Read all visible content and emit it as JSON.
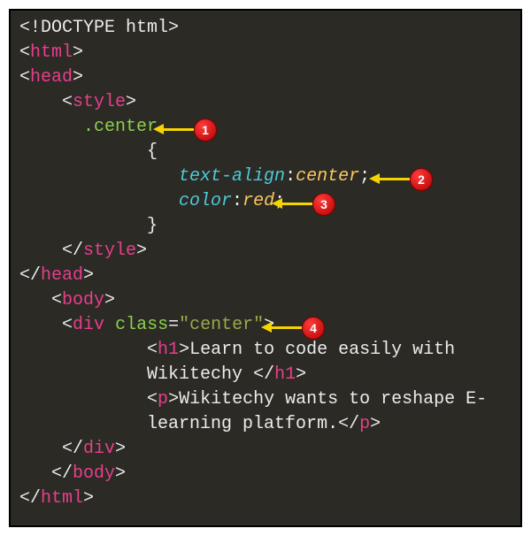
{
  "code": {
    "doctype_open": "<!",
    "doctype_word": "DOCTYPE html",
    "doctype_close": ">",
    "lt": "<",
    "gt": ">",
    "ltc": "</",
    "html": "html",
    "head": "head",
    "style": "style",
    "body": "body",
    "div": "div",
    "h1": "h1",
    "p": "p",
    "class_attr": "class",
    "eq": "=",
    "q": "\"",
    "class_val": "center",
    "selector": ".center",
    "brace_open": "{",
    "brace_close": "}",
    "prop1": "text-align",
    "prop2": "color",
    "colon": ":",
    "semi": ";",
    "val1": "center",
    "val2": "red",
    "h1_text_a": "Learn to code easily with",
    "h1_text_b": "Wikitechy ",
    "p_text_a": "Wikitechy wants to reshape E-",
    "p_text_b": "learning platform.",
    "space": " "
  },
  "annotations": {
    "a1": "1",
    "a2": "2",
    "a3": "3",
    "a4": "4"
  }
}
